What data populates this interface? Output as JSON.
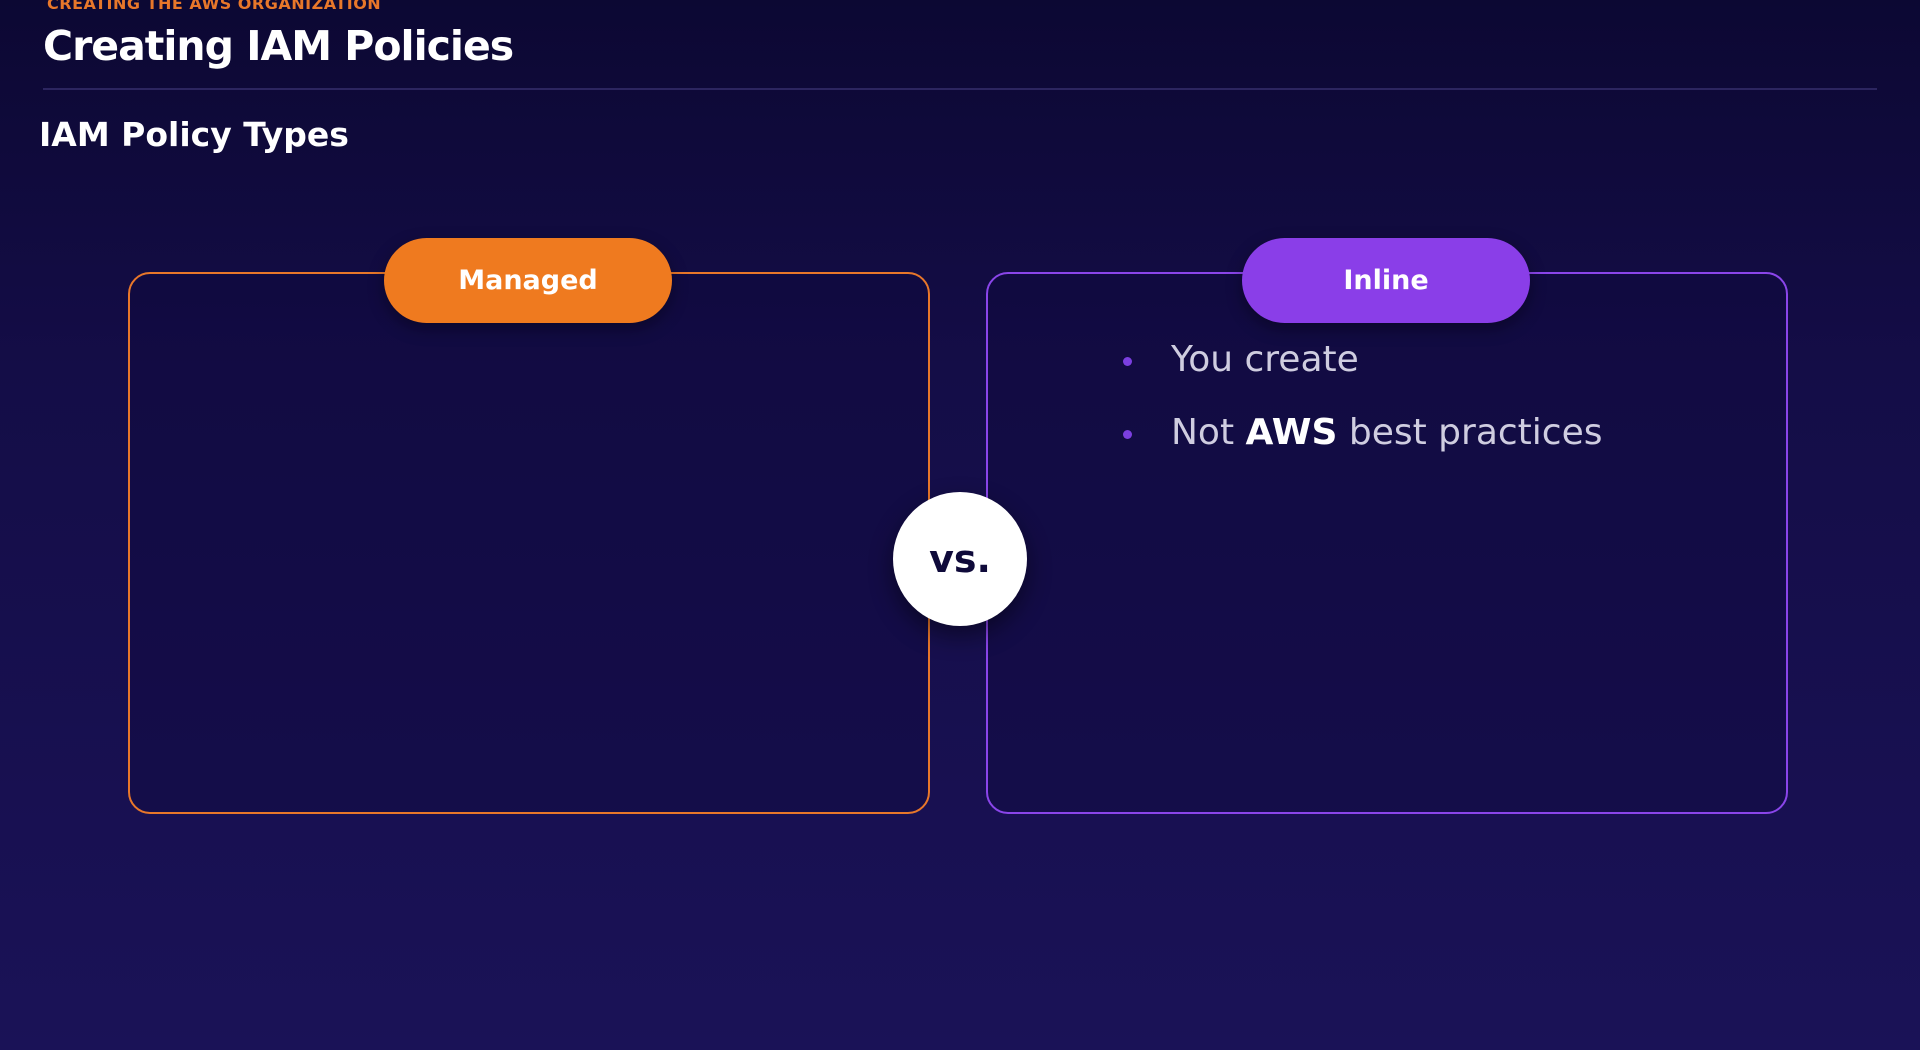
{
  "header": {
    "eyebrow": "CREATING THE AWS ORGANIZATION",
    "title": "Creating IAM Policies"
  },
  "section": {
    "title": "IAM Policy Types"
  },
  "comparison": {
    "left": {
      "label": "Managed",
      "color": "#ef7a1f"
    },
    "right": {
      "label": "Inline",
      "color": "#8a3ee8",
      "bullets": [
        {
          "text": "You create"
        },
        {
          "pre": "Not ",
          "emphasis": "AWS",
          "post": " best practices"
        }
      ]
    },
    "vs_label": "vs."
  }
}
